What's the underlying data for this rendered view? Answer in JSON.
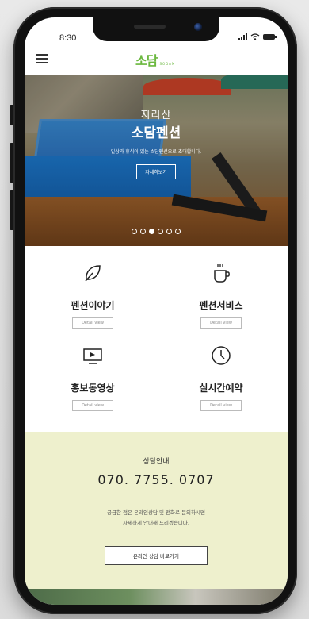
{
  "status": {
    "time": "8:30"
  },
  "header": {
    "logo": "소담",
    "logo_sub": "SODAM"
  },
  "hero": {
    "subtitle": "지리산",
    "title": "소담펜션",
    "description": "일상과 휴식이 있는 소담펜션으로 초대합니다.",
    "button": "자세히보기",
    "slide_count": 6,
    "active_slide": 3
  },
  "menu": [
    {
      "icon": "leaf-icon",
      "label": "펜션이야기",
      "detail": "Detail view"
    },
    {
      "icon": "coffee-cup-icon",
      "label": "펜션서비스",
      "detail": "Detail view"
    },
    {
      "icon": "video-play-icon",
      "label": "홍보동영상",
      "detail": "Detail view"
    },
    {
      "icon": "clock-icon",
      "label": "실시간예약",
      "detail": "Detail view"
    }
  ],
  "contact": {
    "title": "상담안내",
    "phone": "070. 7755. 0707",
    "desc_line1": "궁금한 점은 온라인상담 및 전화로 문의하시면",
    "desc_line2": "자세하게 안내해 드리겠습니다.",
    "button": "온라인 상담 바로가기"
  },
  "colors": {
    "brand": "#6bb83f",
    "contact_bg": "#eef0cd"
  }
}
